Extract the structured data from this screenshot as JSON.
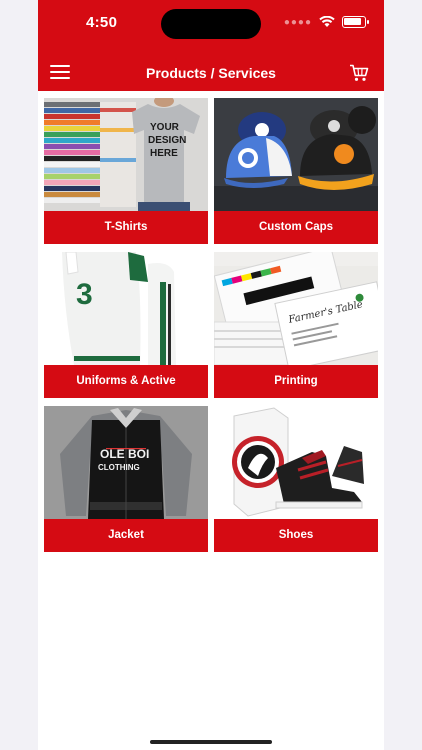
{
  "status_bar": {
    "time": "4:50"
  },
  "header": {
    "title": "Products / Services"
  },
  "products": [
    {
      "label": "T-Shirts",
      "shirt_text": [
        "YOUR",
        "DESIGN",
        "HERE"
      ]
    },
    {
      "label": "Custom Caps"
    },
    {
      "label": "Uniforms & Active",
      "jersey_number": "3"
    },
    {
      "label": "Printing",
      "card_text": "Farmer's Table"
    },
    {
      "label": "Jacket",
      "jacket_text": [
        "OLE BOI",
        "CLOTHING"
      ]
    },
    {
      "label": "Shoes"
    }
  ],
  "colors": {
    "brand_red": "#d50b13"
  }
}
